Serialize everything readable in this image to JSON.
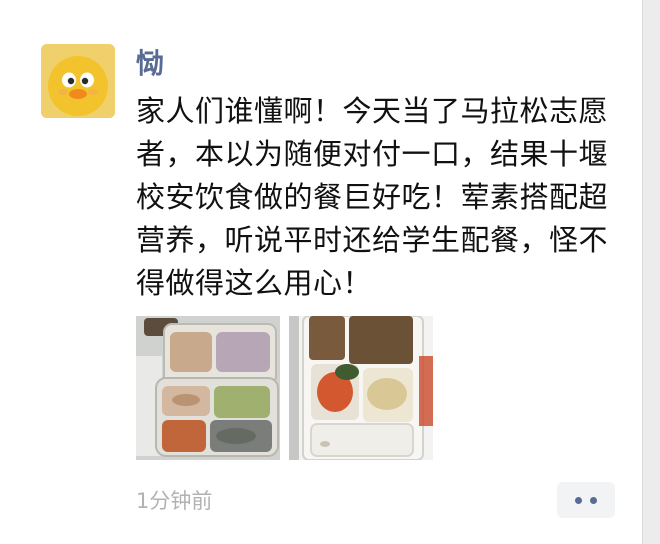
{
  "post": {
    "username": "恸",
    "text": "家人们谁懂啊！今天当了马拉松志愿者，本以为随便对付一口，结果十堰校安饮食做的餐巨好吃！荤素搭配超营养，听说平时还给学生配餐，怪不得做得这么用心！",
    "time": "1分钟前"
  },
  "icons": {
    "avatar": "yellow-duck-avatar",
    "more": "more-dots-icon"
  },
  "colors": {
    "username": "#576b95",
    "text": "#111111",
    "time": "#b2b2b2",
    "more_button_bg": "#f2f3f5"
  }
}
